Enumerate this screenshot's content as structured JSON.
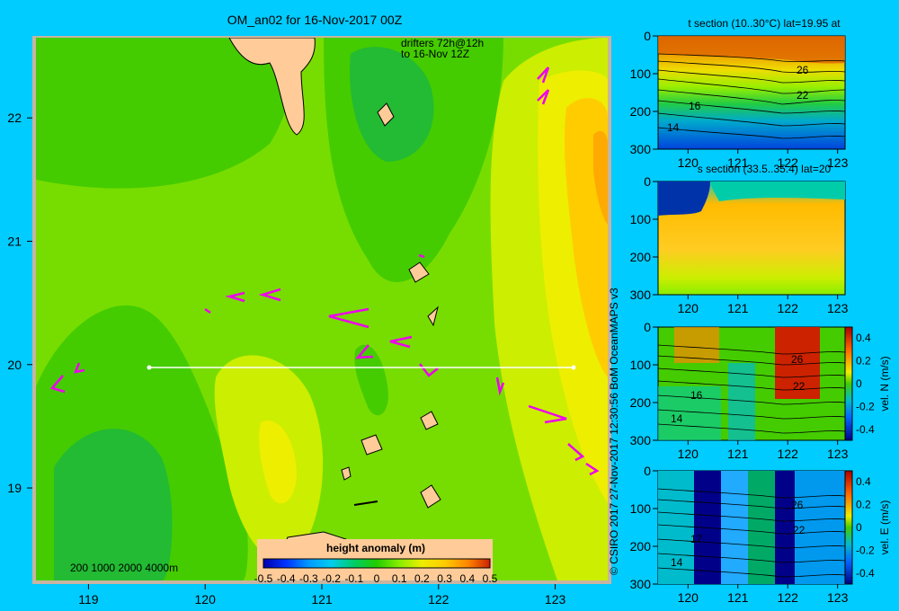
{
  "map": {
    "title": "OM_an02 for 16-Nov-2017 00Z",
    "drifter_note_line1": "drifters 72h@12h",
    "drifter_note_line2": "to 16-Nov 12Z",
    "lon_ticks": [
      "119",
      "120",
      "121",
      "122",
      "123"
    ],
    "lat_ticks": [
      "22",
      "21",
      "20",
      "19"
    ],
    "bathy_label": "200  1000  2000  4000m",
    "section_line_lat": 20,
    "colorbar": {
      "label": "height anomaly (m)",
      "ticks": [
        "-0.5",
        "-0.4",
        "-0.3",
        "-0.2",
        "-0.1",
        "0",
        "0.1",
        "0.2",
        "0.3",
        "0.4",
        "0.5"
      ]
    }
  },
  "credit": "© CSIRO 2017   27-Nov-2017 12:30:56 BoM OceanMAPS v3",
  "panels": [
    {
      "title": "t section (10..30°C) lat=19.95 at",
      "y_ticks": [
        "0",
        "100",
        "200",
        "300"
      ],
      "x_ticks": [
        "120",
        "121",
        "122",
        "123"
      ],
      "contour_labels": [
        "26",
        "22",
        "16",
        "14"
      ]
    },
    {
      "title": "s section (33.5..35.4) lat=20",
      "y_ticks": [
        "0",
        "100",
        "200",
        "300"
      ],
      "x_ticks": [
        "120",
        "121",
        "122",
        "123"
      ],
      "contour_labels": []
    },
    {
      "title": "",
      "y_ticks": [
        "0",
        "100",
        "200",
        "300"
      ],
      "x_ticks": [
        "120",
        "121",
        "122",
        "123"
      ],
      "contour_labels": [
        "26",
        "22",
        "16",
        "14"
      ],
      "cbar_label": "vel. N (m/s)",
      "cbar_ticks": [
        "0.4",
        "0.2",
        "0",
        "-0.2",
        "-0.4"
      ]
    },
    {
      "title": "",
      "y_ticks": [
        "0",
        "100",
        "200",
        "300"
      ],
      "x_ticks": [
        "120",
        "121",
        "122",
        "123"
      ],
      "contour_labels": [
        "26",
        "22",
        "17",
        "14"
      ],
      "cbar_label": "vel. E (m/s)",
      "cbar_ticks": [
        "0.4",
        "0.2",
        "0",
        "-0.2",
        "-0.4"
      ]
    }
  ]
}
